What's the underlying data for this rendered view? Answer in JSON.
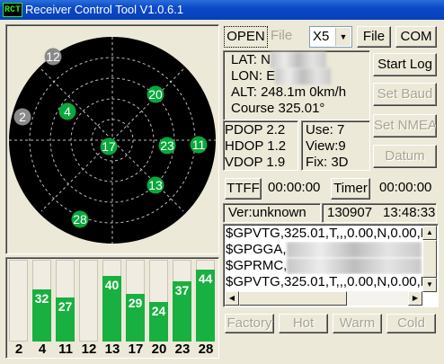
{
  "window": {
    "title": "Receiver Control Tool V1.0.6.1",
    "logo": "RCT"
  },
  "toolbar": {
    "open_label": "OPEN",
    "file_label": "File",
    "port_value": "X5",
    "file_button": "File",
    "com_button": "COM"
  },
  "position": {
    "lat_label": "LAT:",
    "lat_value": "N",
    "lon_label": "LON:",
    "lon_value": "E",
    "alt_label": "ALT:",
    "alt_value": "248.1m",
    "speed_value": "0km/h",
    "course_label": "Course",
    "course_value": "325.01°"
  },
  "side_buttons": {
    "start_log": "Start Log",
    "set_baud": "Set Baud",
    "set_nmea": "Set NMEA",
    "datum": "Datum"
  },
  "dop": {
    "pdop_label": "PDOP",
    "pdop_value": "2.2",
    "hdop_label": "HDOP",
    "hdop_value": "1.2",
    "vdop_label": "VDOP",
    "vdop_value": "1.9"
  },
  "sats": {
    "use_label": "Use:",
    "use_value": "7",
    "view_label": "View:",
    "view_value": "9",
    "fix_label": "Fix:",
    "fix_value": "3D"
  },
  "timing": {
    "ttff_button": "TTFF",
    "ttff_value": "00:00:00",
    "timer_button": "Timer",
    "timer_value": "00:00:00"
  },
  "status": {
    "version": "Ver:unknown",
    "date": "130907",
    "time": "13:48:33"
  },
  "nmea": [
    "$GPVTG,325.01,T,,,0.00,N,0.00,K",
    "$GPGGA,",
    "$GPRMC,",
    "$GPVTG,325.01,T,,,0.00,N,0.00,K"
  ],
  "reset_buttons": {
    "factory": "Factory",
    "hot": "Hot",
    "warm": "Warm",
    "cold": "Cold"
  },
  "colors": {
    "used_sat": "#0aa83c",
    "unused_sat": "#8a8a8a",
    "bar_fill": "#18b040",
    "bar_empty": "#f0ece2"
  },
  "skyplot": {
    "satellites": [
      {
        "prn": "12",
        "used": false
      },
      {
        "prn": "2",
        "used": false
      },
      {
        "prn": "4",
        "used": true
      },
      {
        "prn": "20",
        "used": true
      },
      {
        "prn": "17",
        "used": true
      },
      {
        "prn": "23",
        "used": true
      },
      {
        "prn": "11",
        "used": true
      },
      {
        "prn": "13",
        "used": true
      },
      {
        "prn": "28",
        "used": true
      }
    ]
  },
  "snr": {
    "bars": [
      {
        "prn": "2",
        "snr": null,
        "used": false
      },
      {
        "prn": "4",
        "snr": "32",
        "used": true
      },
      {
        "prn": "11",
        "snr": "27",
        "used": true
      },
      {
        "prn": "12",
        "snr": null,
        "used": false
      },
      {
        "prn": "13",
        "snr": "40",
        "used": true
      },
      {
        "prn": "17",
        "snr": "29",
        "used": true
      },
      {
        "prn": "20",
        "snr": "24",
        "used": true
      },
      {
        "prn": "23",
        "snr": "37",
        "used": true
      },
      {
        "prn": "28",
        "snr": "44",
        "used": true
      }
    ],
    "max": 50
  }
}
